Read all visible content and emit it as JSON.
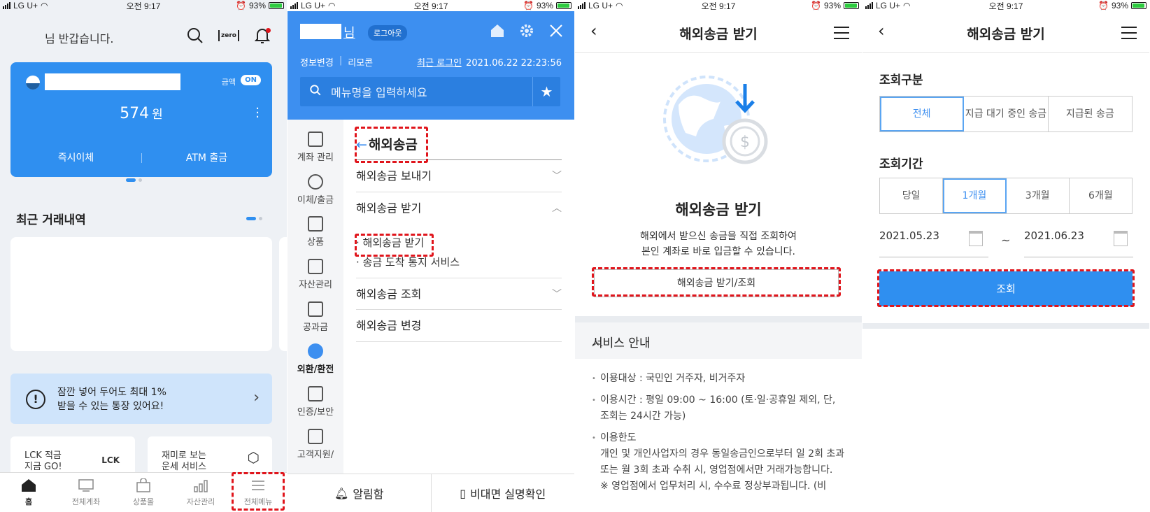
{
  "statusbar": {
    "carrier": "LG U+",
    "time": "오전 9:17",
    "battery": "93%"
  },
  "home": {
    "greeting": "님 반갑습니다.",
    "zero_label": "zero",
    "card": {
      "amount_label": "금액",
      "on_badge": "ON",
      "amount": "574",
      "unit": "원",
      "transfer": "즉시이체",
      "atm": "ATM 출금"
    },
    "recent_title": "최근 거래내역",
    "banner_line1": "잠깐 넣어 두어도 최대 1%",
    "banner_line2": "받을 수 있는 통장 있어요!",
    "banner_icon": "!",
    "promo1": {
      "line1": "LCK 적금",
      "line2": "지금 GO!",
      "logo": "LCK"
    },
    "promo2": {
      "line1": "재미로 보는",
      "line2": "운세 서비스"
    },
    "tabs": [
      "홈",
      "전체계좌",
      "상품몰",
      "자산관리",
      "전체메뉴"
    ]
  },
  "menu": {
    "name_suffix": "님",
    "logout": "로그아웃",
    "info_change": "정보변경",
    "remote": "리모콘",
    "recent_login_label": "최근 로그인",
    "recent_login_time": "2021.06.22 22:23:56",
    "search_placeholder": "메뉴명을 입력하세요",
    "side": [
      "계좌 관리",
      "이체/출금",
      "상품",
      "자산관리",
      "공과금",
      "외환/환전",
      "인증/보안",
      "고객지원/"
    ],
    "section_title": "해외송금",
    "items": [
      "해외송금 보내기",
      "해외송금 받기",
      "해외송금 조회",
      "해외송금 변경"
    ],
    "subitems": [
      "해외송금 받기",
      "송금 도착 통지 서비스"
    ],
    "bottom": [
      "알림함",
      "비대면 실명확인"
    ]
  },
  "receive_intro": {
    "title": "해외송금 받기",
    "hero_title": "해외송금 받기",
    "desc_line1": "해외에서 받으신 송금을 직접 조회하여",
    "desc_line2": "본인 계좌로 바로 입금할 수 있습니다.",
    "button": "해외송금 받기/조회",
    "service_title": "서비스 안내",
    "info": [
      "이용대상 : 국민인 거주자, 비거주자",
      "이용시간 : 평일 09:00 ~ 16:00 (토·일·공휴일 제외, 단, 조회는 24시간 가능)",
      "이용한도",
      "개인 및 개인사업자의 경우 동일송금인으로부터 일 2회 초과 또는 월 3회 초과 수취 시, 영업점에서만 거래가능합니다.",
      "※ 영업점에서 업무처리 시, 수수료 정상부과됩니다. (비"
    ]
  },
  "receive_query": {
    "title": "해외송금 받기",
    "type_label": "조회구분",
    "types": [
      "전체",
      "지급 대기 중인 송금",
      "지급된 송금"
    ],
    "period_label": "조회기간",
    "periods": [
      "당일",
      "1개월",
      "3개월",
      "6개월"
    ],
    "date_from": "2021.05.23",
    "tilde": "~",
    "date_to": "2021.06.23",
    "submit": "조회"
  }
}
